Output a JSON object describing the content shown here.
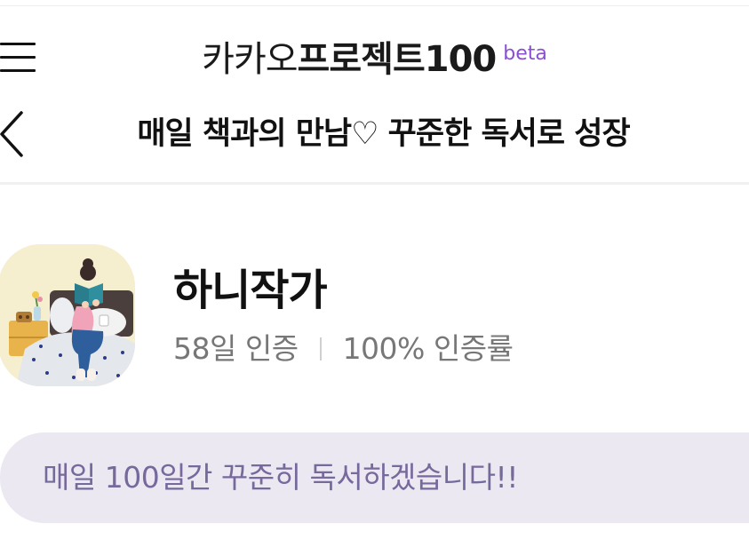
{
  "header": {
    "brand_light": "카카오",
    "brand_bold": "프로젝트100",
    "brand_badge": "beta",
    "menu_icon": "hamburger-menu-icon"
  },
  "nav": {
    "back_icon": "chevron-left-icon",
    "title": "매일 책과의 만남♡ 꾸준한 독서로 성장"
  },
  "profile": {
    "avatar_image": "woman-reading-book-in-bed illustration",
    "name": "하니작가",
    "days_certified": "58일 인증",
    "certification_rate": "100% 인증률"
  },
  "goal": {
    "text": "매일 100일간 꾸준히 독서하겠습니다!!"
  },
  "colors": {
    "beta": "#8a4fd1",
    "goal_bg": "#ebe8f1",
    "goal_text": "#76699c",
    "stats_text": "#777777"
  }
}
